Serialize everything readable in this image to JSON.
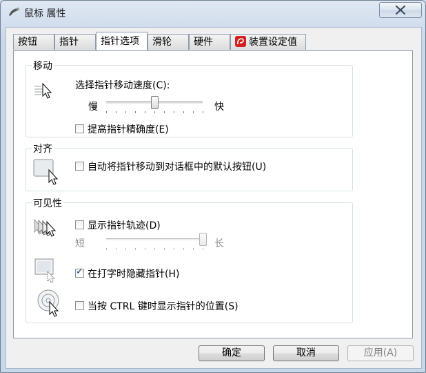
{
  "window": {
    "title": "鼠标 属性",
    "close_symbol": "✕"
  },
  "tabs": [
    {
      "label": "按钮"
    },
    {
      "label": "指针"
    },
    {
      "label": "指针选项"
    },
    {
      "label": "滑轮"
    },
    {
      "label": "硬件"
    },
    {
      "label": "装置设定值",
      "icon": "synaptics-icon"
    }
  ],
  "active_tab": "指针选项",
  "motion": {
    "title": "移动",
    "speed_label": "选择指针移动速度(C):",
    "slow": "慢",
    "fast": "快",
    "speed_level_fraction": 0.5,
    "enhance_precision": {
      "label": "提高指针精确度(E)",
      "checked": false
    }
  },
  "snap_to": {
    "title": "对齐",
    "auto_move": {
      "label": "自动将指针移动到对话框中的默认按钮(U)",
      "checked": false
    }
  },
  "visibility": {
    "title": "可见性",
    "trails": {
      "label": "显示指针轨迹(D)",
      "checked": false
    },
    "short": "短",
    "long": "长",
    "trail_length_fraction": 1.0,
    "hide_typing": {
      "label": "在打字时隐藏指针(H)",
      "checked": true
    },
    "show_ctrl": {
      "label": "当按 CTRL 键时显示指针的位置(S)",
      "checked": false
    }
  },
  "buttons": {
    "ok": "确定",
    "cancel": "取消",
    "apply": "应用(A)"
  }
}
